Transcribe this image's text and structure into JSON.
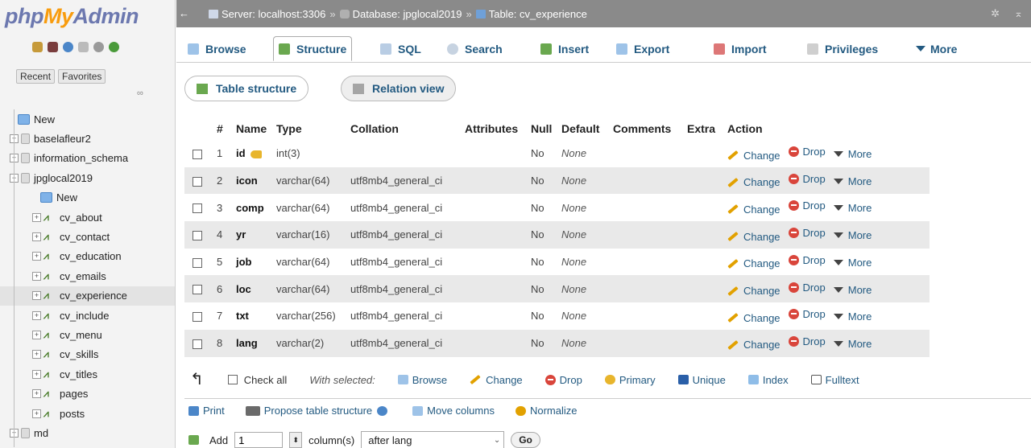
{
  "logo": {
    "php": "php",
    "my": "My",
    "admin": "Admin"
  },
  "nav_tabs": {
    "recent": "Recent",
    "favorites": "Favorites"
  },
  "tree": [
    {
      "label": "New",
      "kind": "new",
      "level": 0
    },
    {
      "label": "baselafleur2",
      "kind": "db",
      "level": 0
    },
    {
      "label": "information_schema",
      "kind": "db",
      "level": 0
    },
    {
      "label": "jpglocal2019",
      "kind": "db",
      "level": 0,
      "expanded": true
    },
    {
      "label": "New",
      "kind": "new",
      "level": 1
    },
    {
      "label": "cv_about",
      "kind": "table",
      "level": 1
    },
    {
      "label": "cv_contact",
      "kind": "table",
      "level": 1
    },
    {
      "label": "cv_education",
      "kind": "table",
      "level": 1
    },
    {
      "label": "cv_emails",
      "kind": "table",
      "level": 1
    },
    {
      "label": "cv_experience",
      "kind": "table",
      "level": 1,
      "active": true
    },
    {
      "label": "cv_include",
      "kind": "table",
      "level": 1
    },
    {
      "label": "cv_menu",
      "kind": "table",
      "level": 1
    },
    {
      "label": "cv_skills",
      "kind": "table",
      "level": 1
    },
    {
      "label": "cv_titles",
      "kind": "table",
      "level": 1
    },
    {
      "label": "pages",
      "kind": "table",
      "level": 1
    },
    {
      "label": "posts",
      "kind": "table",
      "level": 1
    },
    {
      "label": "md",
      "kind": "db",
      "level": 0
    }
  ],
  "breadcrumb": {
    "server": "Server: localhost:3306",
    "database": "Database: jpglocal2019",
    "table": "Table: cv_experience",
    "sep": "»"
  },
  "menu_tabs": [
    "Browse",
    "Structure",
    "SQL",
    "Search",
    "Insert",
    "Export",
    "Import",
    "Privileges",
    "More"
  ],
  "sub_tabs": {
    "structure": "Table structure",
    "relation": "Relation view"
  },
  "columns": [
    "#",
    "Name",
    "Type",
    "Collation",
    "Attributes",
    "Null",
    "Default",
    "Comments",
    "Extra",
    "Action"
  ],
  "rows": [
    {
      "num": "1",
      "name": "id",
      "type": "int(3)",
      "collation": "",
      "null": "No",
      "default": "None",
      "key": true
    },
    {
      "num": "2",
      "name": "icon",
      "type": "varchar(64)",
      "collation": "utf8mb4_general_ci",
      "null": "No",
      "default": "None"
    },
    {
      "num": "3",
      "name": "comp",
      "type": "varchar(64)",
      "collation": "utf8mb4_general_ci",
      "null": "No",
      "default": "None"
    },
    {
      "num": "4",
      "name": "yr",
      "type": "varchar(16)",
      "collation": "utf8mb4_general_ci",
      "null": "No",
      "default": "None"
    },
    {
      "num": "5",
      "name": "job",
      "type": "varchar(64)",
      "collation": "utf8mb4_general_ci",
      "null": "No",
      "default": "None"
    },
    {
      "num": "6",
      "name": "loc",
      "type": "varchar(64)",
      "collation": "utf8mb4_general_ci",
      "null": "No",
      "default": "None"
    },
    {
      "num": "7",
      "name": "txt",
      "type": "varchar(256)",
      "collation": "utf8mb4_general_ci",
      "null": "No",
      "default": "None"
    },
    {
      "num": "8",
      "name": "lang",
      "type": "varchar(2)",
      "collation": "utf8mb4_general_ci",
      "null": "No",
      "default": "None"
    }
  ],
  "row_actions": {
    "change": "Change",
    "drop": "Drop",
    "more": "More"
  },
  "with_selected": {
    "check_all": "Check all",
    "label": "With selected:",
    "browse": "Browse",
    "change": "Change",
    "drop": "Drop",
    "primary": "Primary",
    "unique": "Unique",
    "index": "Index",
    "fulltext": "Fulltext"
  },
  "tools": {
    "print": "Print",
    "propose": "Propose table structure",
    "move": "Move columns",
    "normalize": "Normalize"
  },
  "add_column": {
    "label": "Add",
    "count": "1",
    "unit": "column(s)",
    "position": "after lang",
    "go": "Go"
  },
  "colors": {
    "link": "#235a81",
    "topbar": "#8a8a8a",
    "stripe": "#e9e9e9",
    "logo_blue": "#6c78af",
    "logo_orange": "#f89c0e"
  }
}
